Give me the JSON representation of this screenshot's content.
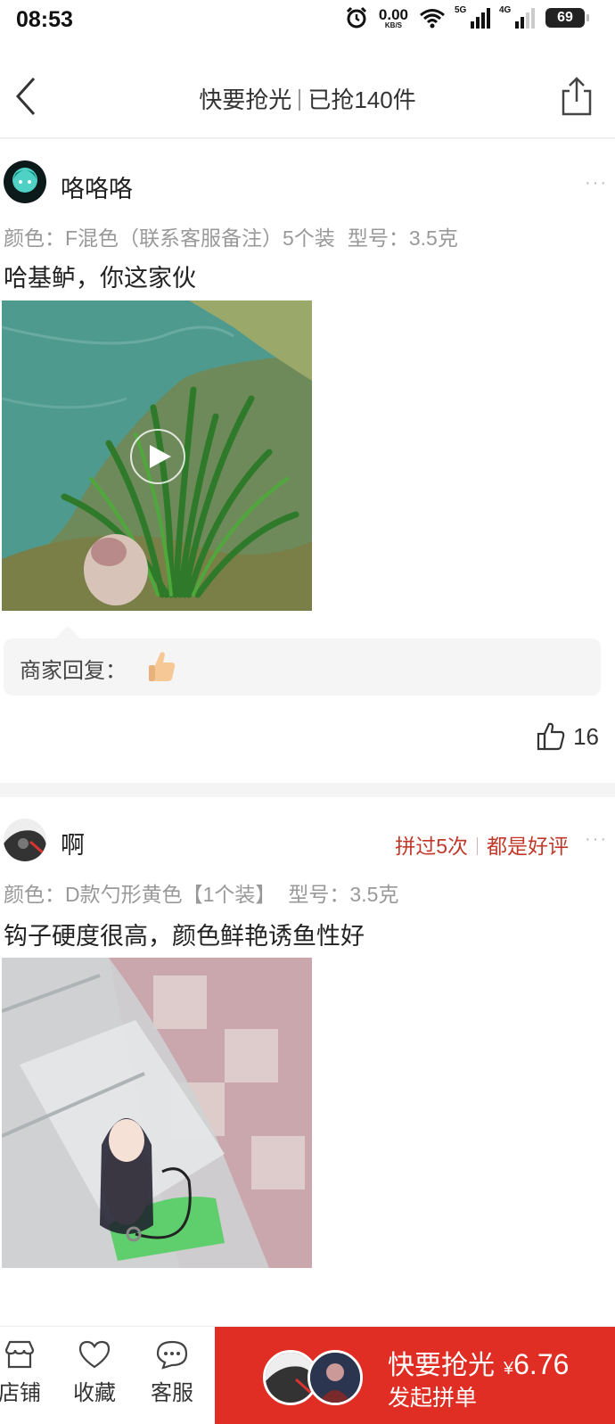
{
  "status_bar": {
    "time": "08:53",
    "net_speed": "0.00",
    "net_unit": "KB/S",
    "sig1": "5G",
    "sig2": "4G",
    "battery": "69"
  },
  "nav": {
    "title_left": "快要抢光",
    "title_right": "已抢140件"
  },
  "reviews": [
    {
      "username": "咯咯咯",
      "more": "···",
      "sku_color": "颜色：F混色（联系客服备注）5个装",
      "sku_model": "型号：3.5克",
      "text": "哈基鲈，你这家伙",
      "reply_label": "商家回复：",
      "likes": "16"
    },
    {
      "username": "啊",
      "more": "···",
      "badge_1": "拼过5次",
      "badge_2": "都是好评",
      "sku_color": "颜色：D款勺形黄色【1个装】",
      "sku_model": "型号：3.5克",
      "text": "钩子硬度很高，颜色鲜艳诱鱼性好"
    }
  ],
  "bottom_bar": {
    "tabs": [
      {
        "label": "店铺",
        "icon": "store-icon"
      },
      {
        "label": "收藏",
        "icon": "heart-icon"
      },
      {
        "label": "客服",
        "icon": "chat-icon"
      }
    ],
    "buy_title": "快要抢光",
    "buy_currency": "¥",
    "buy_price": "6.76",
    "buy_sub": "发起拼单"
  },
  "colors": {
    "accent": "#e02e24",
    "badge": "#c0392b"
  }
}
